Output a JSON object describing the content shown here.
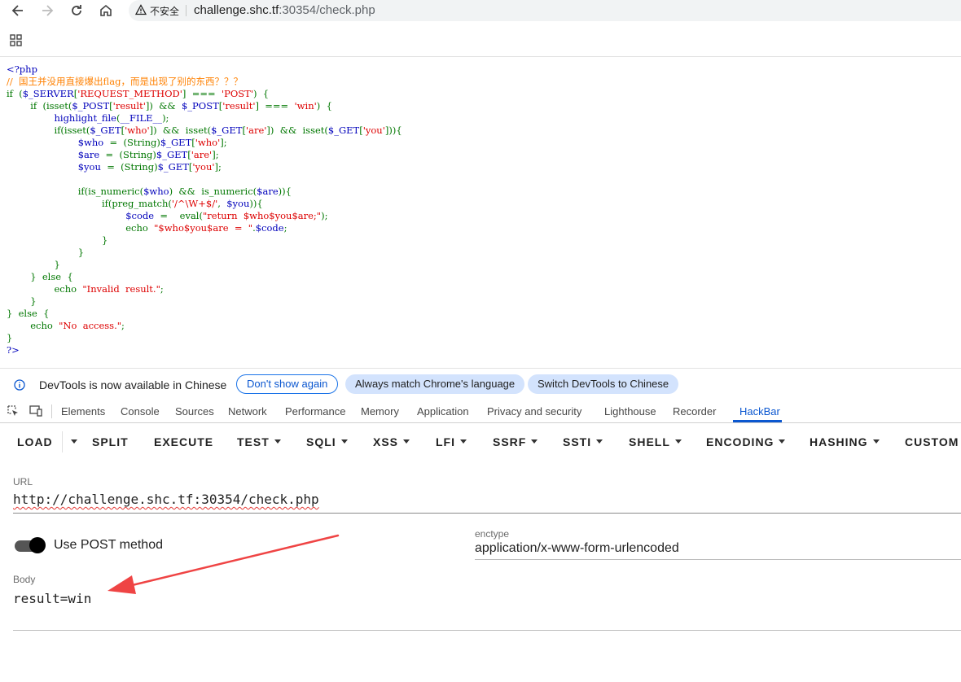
{
  "browser": {
    "security_label": "不安全",
    "url_host": "challenge.shc.tf",
    "url_path": ":30354/check.php"
  },
  "source_code": [
    [
      {
        "c": "b",
        "t": "<?php"
      }
    ],
    [
      {
        "c": "o",
        "t": "//  国王并没用直接爆出flag，而是出现了别的东西？？？"
      }
    ],
    [
      {
        "c": "g",
        "t": "if  ("
      },
      {
        "c": "b",
        "t": "$_SERVER"
      },
      {
        "c": "g",
        "t": "["
      },
      {
        "c": "r",
        "t": "'REQUEST_METHOD'"
      },
      {
        "c": "g",
        "t": "]  ===  "
      },
      {
        "c": "r",
        "t": "'POST'"
      },
      {
        "c": "g",
        "t": ")  {"
      }
    ],
    [
      {
        "c": "g",
        "t": "        if  (isset("
      },
      {
        "c": "b",
        "t": "$_POST"
      },
      {
        "c": "g",
        "t": "["
      },
      {
        "c": "r",
        "t": "'result'"
      },
      {
        "c": "g",
        "t": "])  &&  "
      },
      {
        "c": "b",
        "t": "$_POST"
      },
      {
        "c": "g",
        "t": "["
      },
      {
        "c": "r",
        "t": "'result'"
      },
      {
        "c": "g",
        "t": "]  ===  "
      },
      {
        "c": "r",
        "t": "'win'"
      },
      {
        "c": "g",
        "t": ")  {"
      }
    ],
    [
      {
        "c": "b",
        "t": "                highlight_file"
      },
      {
        "c": "g",
        "t": "("
      },
      {
        "c": "b",
        "t": "__FILE__"
      },
      {
        "c": "g",
        "t": ");"
      }
    ],
    [
      {
        "c": "g",
        "t": "                if(isset("
      },
      {
        "c": "b",
        "t": "$_GET"
      },
      {
        "c": "g",
        "t": "["
      },
      {
        "c": "r",
        "t": "'who'"
      },
      {
        "c": "g",
        "t": "])  &&  isset("
      },
      {
        "c": "b",
        "t": "$_GET"
      },
      {
        "c": "g",
        "t": "["
      },
      {
        "c": "r",
        "t": "'are'"
      },
      {
        "c": "g",
        "t": "])  &&  isset("
      },
      {
        "c": "b",
        "t": "$_GET"
      },
      {
        "c": "g",
        "t": "["
      },
      {
        "c": "r",
        "t": "'you'"
      },
      {
        "c": "g",
        "t": "])){"
      }
    ],
    [
      {
        "c": "b",
        "t": "                        $who  "
      },
      {
        "c": "g",
        "t": "=  (String)"
      },
      {
        "c": "b",
        "t": "$_GET"
      },
      {
        "c": "g",
        "t": "["
      },
      {
        "c": "r",
        "t": "'who'"
      },
      {
        "c": "g",
        "t": "];"
      }
    ],
    [
      {
        "c": "b",
        "t": "                        $are  "
      },
      {
        "c": "g",
        "t": "=  (String)"
      },
      {
        "c": "b",
        "t": "$_GET"
      },
      {
        "c": "g",
        "t": "["
      },
      {
        "c": "r",
        "t": "'are'"
      },
      {
        "c": "g",
        "t": "];"
      }
    ],
    [
      {
        "c": "b",
        "t": "                        $you  "
      },
      {
        "c": "g",
        "t": "=  (String)"
      },
      {
        "c": "b",
        "t": "$_GET"
      },
      {
        "c": "g",
        "t": "["
      },
      {
        "c": "r",
        "t": "'you'"
      },
      {
        "c": "g",
        "t": "];"
      }
    ],
    [
      {
        "c": "g",
        "t": ""
      }
    ],
    [
      {
        "c": "g",
        "t": "                        if(is_numeric("
      },
      {
        "c": "b",
        "t": "$who"
      },
      {
        "c": "g",
        "t": ")  &&  is_numeric("
      },
      {
        "c": "b",
        "t": "$are"
      },
      {
        "c": "g",
        "t": ")){"
      }
    ],
    [
      {
        "c": "g",
        "t": "                                if(preg_match("
      },
      {
        "c": "r",
        "t": "'/^\\W+$/'"
      },
      {
        "c": "g",
        "t": ",  "
      },
      {
        "c": "b",
        "t": "$you"
      },
      {
        "c": "g",
        "t": ")){"
      }
    ],
    [
      {
        "c": "b",
        "t": "                                        $code  "
      },
      {
        "c": "g",
        "t": "=    eval("
      },
      {
        "c": "r",
        "t": "\"return  $who$you$are;\""
      },
      {
        "c": "g",
        "t": ");"
      }
    ],
    [
      {
        "c": "g",
        "t": "                                        echo  "
      },
      {
        "c": "r",
        "t": "\"$who$you$are  =  \""
      },
      {
        "c": "g",
        "t": "."
      },
      {
        "c": "b",
        "t": "$code"
      },
      {
        "c": "g",
        "t": ";"
      }
    ],
    [
      {
        "c": "g",
        "t": "                                }"
      }
    ],
    [
      {
        "c": "g",
        "t": "                        }"
      }
    ],
    [
      {
        "c": "g",
        "t": "                }"
      }
    ],
    [
      {
        "c": "g",
        "t": "        }  else  {"
      }
    ],
    [
      {
        "c": "g",
        "t": "                echo  "
      },
      {
        "c": "r",
        "t": "\"Invalid  result.\""
      },
      {
        "c": "g",
        "t": ";"
      }
    ],
    [
      {
        "c": "g",
        "t": "        }"
      }
    ],
    [
      {
        "c": "g",
        "t": "}  else  {"
      }
    ],
    [
      {
        "c": "g",
        "t": "        echo  "
      },
      {
        "c": "r",
        "t": "\"No  access.\""
      },
      {
        "c": "g",
        "t": ";"
      }
    ],
    [
      {
        "c": "g",
        "t": "}"
      }
    ],
    [
      {
        "c": "b",
        "t": "?>"
      }
    ]
  ],
  "infobar": {
    "message": "DevTools is now available in Chinese",
    "dont_show": "Don't show again",
    "always_match": "Always match Chrome's language",
    "switch": "Switch DevTools to Chinese"
  },
  "devtools_tabs": [
    "Elements",
    "Console",
    "Sources",
    "Network",
    "Performance",
    "Memory",
    "Application",
    "Privacy and security",
    "Lighthouse",
    "Recorder",
    "HackBar"
  ],
  "active_tab": "HackBar",
  "hackbar": {
    "buttons": [
      "LOAD",
      "SPLIT",
      "EXECUTE",
      "TEST",
      "SQLI",
      "XSS",
      "LFI",
      "SSRF",
      "SSTI",
      "SHELL",
      "ENCODING",
      "HASHING",
      "CUSTOM"
    ],
    "url_label": "URL",
    "url_value": "http://challenge.shc.tf:30354/check.php",
    "post_label": "Use POST method",
    "post_enabled": true,
    "enctype_label": "enctype",
    "enctype_value": "application/x-www-form-urlencoded",
    "body_label": "Body",
    "body_value": "result=win"
  },
  "colors": {
    "php_keyword": "#007700",
    "php_default": "#0000bb",
    "php_string": "#dd0000",
    "php_comment": "#ff8000",
    "accent": "#0b57d0",
    "annotation_arrow": "#ef4444"
  }
}
